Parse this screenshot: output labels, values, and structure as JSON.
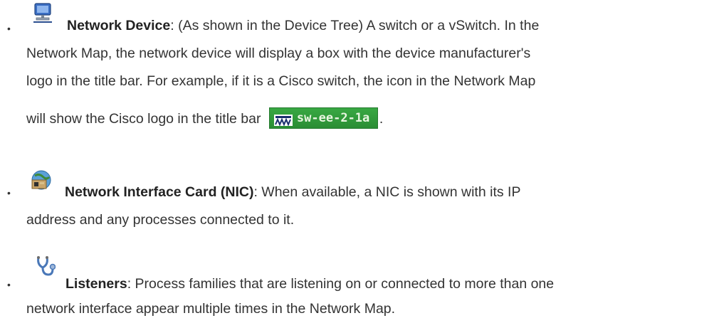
{
  "items": [
    {
      "icon": "monitor-icon",
      "term": "Network Device",
      "lines": [
        ": (As shown in the Device Tree) A switch or a vSwitch. In the",
        "Network Map, the network device will display a box with the device manufacturer's",
        "logo in the title bar. For example, if it is a Cisco switch, the icon in the Network Map",
        "will show the Cisco logo in the title bar"
      ],
      "badge": {
        "icon": "cisco-logo-icon",
        "text": "sw-ee-2-1a",
        "color": "#2e9a39"
      },
      "trailing": "."
    },
    {
      "icon": "nic-card-icon",
      "term": "Network Interface Card (NIC)",
      "lines": [
        ": When available, a NIC is shown with its IP",
        "address and any processes connected to it."
      ]
    },
    {
      "icon": "stethoscope-icon",
      "term": "Listeners",
      "lines": [
        ": Process families that are listening on or connected to more than one",
        "network interface appear multiple times in the Network Map."
      ]
    }
  ]
}
